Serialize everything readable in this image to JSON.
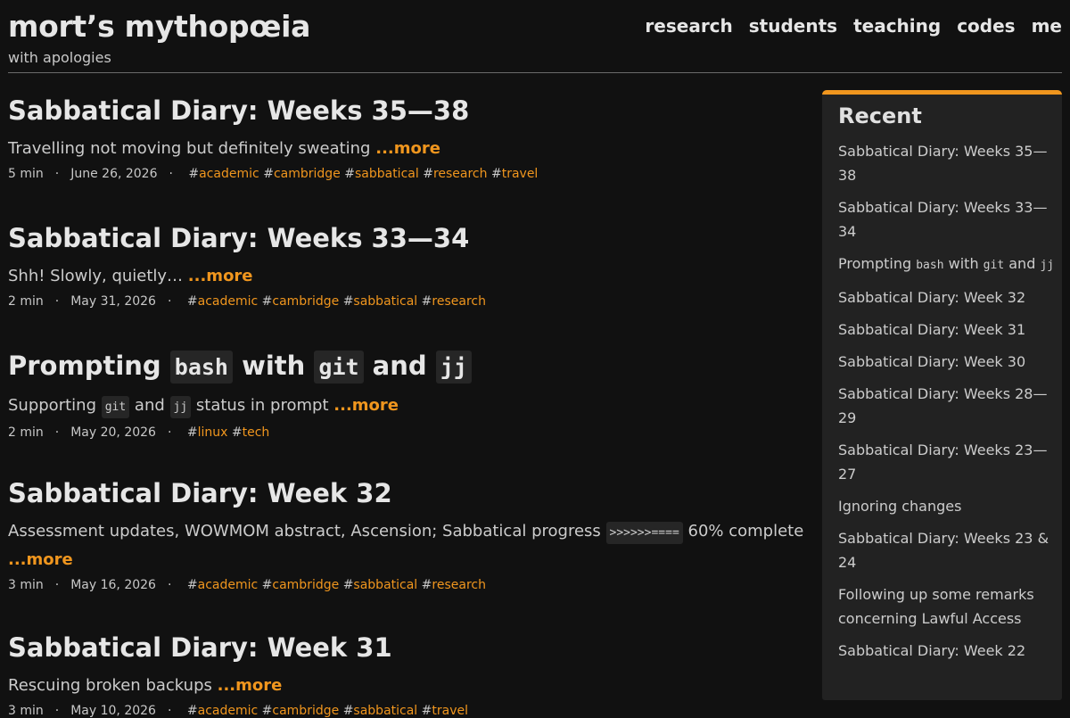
{
  "site": {
    "title": "mort’s mythopœia",
    "tagline": "with apologies"
  },
  "nav": [
    "research",
    "students",
    "teaching",
    "codes",
    "me"
  ],
  "more_label": "...more",
  "posts": [
    {
      "title": "Sabbatical Diary: Weeks 35—38",
      "summary": "Travelling not moving but definitely sweating",
      "read_time": "5 min",
      "date": "June 26, 2026",
      "tags": [
        "academic",
        "cambridge",
        "sabbatical",
        "research",
        "travel"
      ]
    },
    {
      "title": "Sabbatical Diary: Weeks 33—34",
      "summary": "Shh! Slowly, quietly…",
      "read_time": "2 min",
      "date": "May 31, 2026",
      "tags": [
        "academic",
        "cambridge",
        "sabbatical",
        "research"
      ]
    },
    {
      "title_parts": [
        "Prompting ",
        "bash",
        " with ",
        "git",
        " and ",
        "jj"
      ],
      "summary_parts": [
        "Supporting ",
        "git",
        " and ",
        "jj",
        " status in prompt"
      ],
      "read_time": "2 min",
      "date": "May 20, 2026",
      "tags": [
        "linux",
        "tech"
      ]
    },
    {
      "title": "Sabbatical Diary: Week 32",
      "summary_parts": [
        "Assessment updates, WOWMOM abstract, Ascension; Sabbatical progress ",
        ">>>>>>====",
        " 60% complete"
      ],
      "read_time": "3 min",
      "date": "May 16, 2026",
      "tags": [
        "academic",
        "cambridge",
        "sabbatical",
        "research"
      ]
    },
    {
      "title": "Sabbatical Diary: Week 31",
      "summary": "Rescuing broken backups",
      "read_time": "3 min",
      "date": "May 10, 2026",
      "tags": [
        "academic",
        "cambridge",
        "sabbatical",
        "travel"
      ]
    }
  ],
  "sidebar": {
    "title": "Recent",
    "items": [
      "Sabbatical Diary: Weeks 35—38",
      "Sabbatical Diary: Weeks 33—34",
      "Prompting bash with git and jj",
      "Sabbatical Diary: Week 32",
      "Sabbatical Diary: Week 31",
      "Sabbatical Diary: Week 30",
      "Sabbatical Diary: Weeks 28—29",
      "Sabbatical Diary: Weeks 23—27",
      "Ignoring changes",
      "Sabbatical Diary: Weeks 23 & 24",
      "Following up some remarks concerning Lawful Access",
      "Sabbatical Diary: Week 22"
    ],
    "prompting_parts": [
      "Prompting ",
      "bash",
      " with ",
      "git",
      " and ",
      "jj"
    ]
  },
  "colors": {
    "accent": "#f0961e",
    "background": "#111111",
    "sidebar_background": "#222222"
  }
}
